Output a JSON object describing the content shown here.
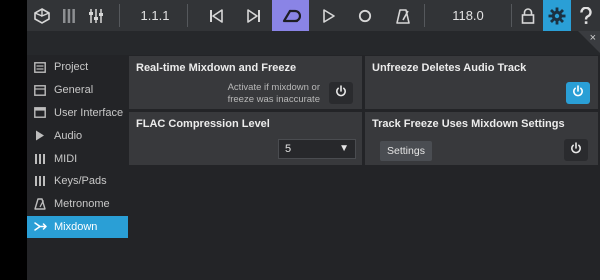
{
  "toolbar": {
    "position": "1.1.1",
    "tempo": "118.0",
    "icons": [
      "logo-icon",
      "mixer-icon",
      "fader-icon",
      "skip-back-icon",
      "skip-forward-icon",
      "loop-icon",
      "play-icon",
      "record-icon",
      "metronome-icon",
      "lock-icon",
      "gear-icon",
      "help-icon"
    ]
  },
  "panel": {
    "close_label": "×"
  },
  "sidebar": {
    "items": [
      {
        "label": "Project",
        "icon": "project-icon"
      },
      {
        "label": "General",
        "icon": "general-icon"
      },
      {
        "label": "User Interface",
        "icon": "user-interface-icon"
      },
      {
        "label": "Audio",
        "icon": "audio-icon"
      },
      {
        "label": "MIDI",
        "icon": "midi-icon"
      },
      {
        "label": "Keys/Pads",
        "icon": "keys-pads-icon"
      },
      {
        "label": "Metronome",
        "icon": "metronome-icon"
      },
      {
        "label": "Mixdown",
        "icon": "mixdown-icon",
        "active": true
      }
    ]
  },
  "settings": {
    "realtime_mixdown": {
      "title": "Real-time Mixdown and Freeze",
      "hint_line1": "Activate if mixdown or",
      "hint_line2": "freeze was inaccurate",
      "enabled": false
    },
    "unfreeze_deletes": {
      "title": "Unfreeze Deletes Audio Track",
      "enabled": true
    },
    "flac_compression": {
      "title": "FLAC Compression Level",
      "value": "5"
    },
    "track_freeze": {
      "title": "Track Freeze Uses Mixdown Settings",
      "settings_label": "Settings",
      "enabled": false
    }
  },
  "colors": {
    "accent_blue": "#2a9fd6",
    "loop_purple": "#8a84e6"
  }
}
